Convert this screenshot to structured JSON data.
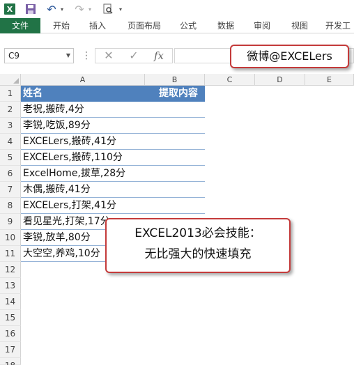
{
  "app": {
    "logo_text": "X"
  },
  "ribbon": {
    "tabs": [
      {
        "label": "文件",
        "name": "tab-file"
      },
      {
        "label": "开始",
        "name": "tab-home"
      },
      {
        "label": "插入",
        "name": "tab-insert"
      },
      {
        "label": "页面布局",
        "name": "tab-page-layout"
      },
      {
        "label": "公式",
        "name": "tab-formulas"
      },
      {
        "label": "数据",
        "name": "tab-data"
      },
      {
        "label": "审阅",
        "name": "tab-review"
      },
      {
        "label": "视图",
        "name": "tab-view"
      },
      {
        "label": "开发工",
        "name": "tab-developer"
      }
    ]
  },
  "formula_bar": {
    "name_box": "C9",
    "fx_label": "fx",
    "formula": ""
  },
  "callouts": {
    "watermark": "微博@EXCELers",
    "title_line1": "EXCEL2013必会技能：",
    "title_line2": "无比强大的快速填充"
  },
  "sheet": {
    "columns": [
      "A",
      "B",
      "C",
      "D",
      "E"
    ],
    "header": {
      "a": "姓名",
      "b": "提取内容"
    },
    "rows": [
      {
        "n": "1"
      },
      {
        "n": "2",
        "a": "老祝,搬砖,4分"
      },
      {
        "n": "3",
        "a": "李锐,吃饭,89分"
      },
      {
        "n": "4",
        "a": "EXCELers,搬砖,41分"
      },
      {
        "n": "5",
        "a": "EXCELers,搬砖,110分"
      },
      {
        "n": "6",
        "a": "ExcelHome,拔草,28分"
      },
      {
        "n": "7",
        "a": "木偶,搬砖,41分"
      },
      {
        "n": "8",
        "a": "EXCELers,打架,41分"
      },
      {
        "n": "9",
        "a": "看见星光,打架,17分"
      },
      {
        "n": "10",
        "a": "李锐,放羊,80分"
      },
      {
        "n": "11",
        "a": "大空空,养鸡,10分"
      },
      {
        "n": "12"
      },
      {
        "n": "13"
      },
      {
        "n": "14"
      },
      {
        "n": "15"
      },
      {
        "n": "16"
      },
      {
        "n": "17"
      },
      {
        "n": "18"
      }
    ]
  },
  "colors": {
    "excel_green": "#217346",
    "table_header": "#4f81bd",
    "callout_border": "#c43a3a"
  }
}
